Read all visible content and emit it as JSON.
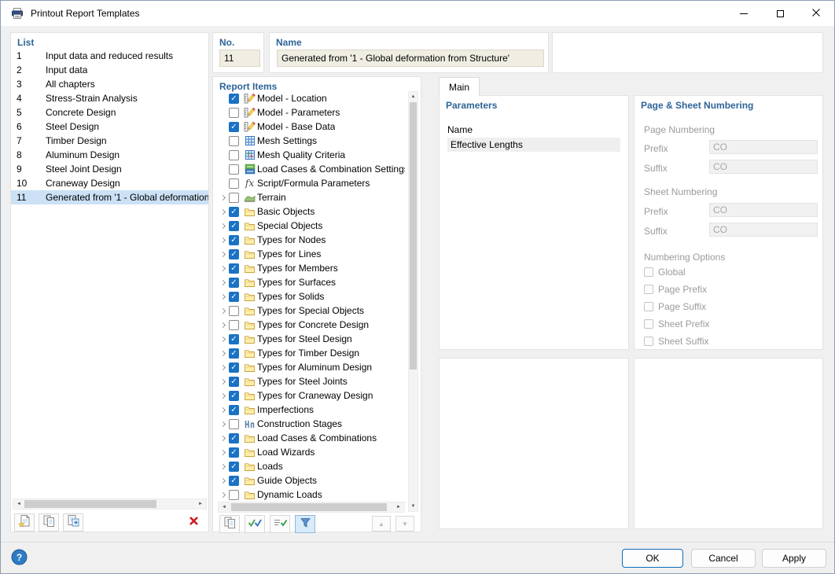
{
  "window": {
    "title": "Printout Report Templates"
  },
  "list_panel": {
    "header": "List",
    "items": [
      {
        "no": "1",
        "name": "Input data and reduced results",
        "selected": false
      },
      {
        "no": "2",
        "name": "Input data",
        "selected": false
      },
      {
        "no": "3",
        "name": "All chapters",
        "selected": false
      },
      {
        "no": "4",
        "name": "Stress-Strain Analysis",
        "selected": false
      },
      {
        "no": "5",
        "name": "Concrete Design",
        "selected": false
      },
      {
        "no": "6",
        "name": "Steel Design",
        "selected": false
      },
      {
        "no": "7",
        "name": "Timber Design",
        "selected": false
      },
      {
        "no": "8",
        "name": "Aluminum Design",
        "selected": false
      },
      {
        "no": "9",
        "name": "Steel Joint Design",
        "selected": false
      },
      {
        "no": "10",
        "name": "Craneway Design",
        "selected": false
      },
      {
        "no": "11",
        "name": "Generated from '1 - Global deformation",
        "selected": true
      }
    ]
  },
  "header_fields": {
    "no_label": "No.",
    "no_value": "11",
    "name_label": "Name",
    "name_value": "Generated from '1 - Global deformation from Structure'"
  },
  "report_items": {
    "header": "Report Items",
    "items": [
      {
        "label": "Model - Location",
        "checked": true,
        "icon": "model",
        "expand": false
      },
      {
        "label": "Model - Parameters",
        "checked": false,
        "icon": "model",
        "expand": false
      },
      {
        "label": "Model - Base Data",
        "checked": true,
        "icon": "model",
        "expand": false
      },
      {
        "label": "Mesh Settings",
        "checked": false,
        "icon": "mesh",
        "expand": false
      },
      {
        "label": "Mesh Quality Criteria",
        "checked": false,
        "icon": "mesh-quality",
        "expand": false
      },
      {
        "label": "Load Cases & Combination Settings",
        "checked": false,
        "icon": "load-settings",
        "expand": false
      },
      {
        "label": "Script/Formula Parameters",
        "checked": false,
        "icon": "formula",
        "expand": false
      },
      {
        "label": "Terrain",
        "checked": false,
        "icon": "terrain",
        "expand": true
      },
      {
        "label": "Basic Objects",
        "checked": true,
        "icon": "folder",
        "expand": true
      },
      {
        "label": "Special Objects",
        "checked": true,
        "icon": "folder",
        "expand": true
      },
      {
        "label": "Types for Nodes",
        "checked": true,
        "icon": "folder",
        "expand": true
      },
      {
        "label": "Types for Lines",
        "checked": true,
        "icon": "folder",
        "expand": true
      },
      {
        "label": "Types for Members",
        "checked": true,
        "icon": "folder",
        "expand": true
      },
      {
        "label": "Types for Surfaces",
        "checked": true,
        "icon": "folder",
        "expand": true
      },
      {
        "label": "Types for Solids",
        "checked": true,
        "icon": "folder",
        "expand": true
      },
      {
        "label": "Types for Special Objects",
        "checked": false,
        "icon": "folder",
        "expand": true
      },
      {
        "label": "Types for Concrete Design",
        "checked": false,
        "icon": "folder",
        "expand": true
      },
      {
        "label": "Types for Steel Design",
        "checked": true,
        "icon": "folder",
        "expand": true
      },
      {
        "label": "Types for Timber Design",
        "checked": true,
        "icon": "folder",
        "expand": true
      },
      {
        "label": "Types for Aluminum Design",
        "checked": true,
        "icon": "folder",
        "expand": true
      },
      {
        "label": "Types for Steel Joints",
        "checked": true,
        "icon": "folder",
        "expand": true
      },
      {
        "label": "Types for Craneway Design",
        "checked": true,
        "icon": "folder",
        "expand": true
      },
      {
        "label": "Imperfections",
        "checked": true,
        "icon": "folder",
        "expand": true
      },
      {
        "label": "Construction Stages",
        "checked": false,
        "icon": "construction-stages",
        "expand": true
      },
      {
        "label": "Load Cases & Combinations",
        "checked": true,
        "icon": "folder",
        "expand": true
      },
      {
        "label": "Load Wizards",
        "checked": true,
        "icon": "folder",
        "expand": true
      },
      {
        "label": "Loads",
        "checked": true,
        "icon": "folder",
        "expand": true
      },
      {
        "label": "Guide Objects",
        "checked": true,
        "icon": "folder",
        "expand": true
      },
      {
        "label": "Dynamic Loads",
        "checked": false,
        "icon": "folder",
        "expand": true
      }
    ]
  },
  "main_tab": {
    "label": "Main"
  },
  "parameters": {
    "header": "Parameters",
    "name_label": "Name",
    "rows": [
      {
        "value": "Effective Lengths"
      }
    ]
  },
  "numbering": {
    "header": "Page & Sheet Numbering",
    "page_section": "Page Numbering",
    "sheet_section": "Sheet Numbering",
    "prefix_label": "Prefix",
    "suffix_label": "Suffix",
    "page_prefix": "CO",
    "page_suffix": "CO",
    "sheet_prefix": "CO",
    "sheet_suffix": "CO",
    "options_label": "Numbering Options",
    "options": [
      "Global",
      "Page Prefix",
      "Page Suffix",
      "Sheet Prefix",
      "Sheet Suffix"
    ]
  },
  "toolbars": {
    "list": [
      "new-template",
      "copy-template",
      "template-from-file",
      "delete-template"
    ],
    "tree": [
      "copy-items",
      "check-selection",
      "check-subitems",
      "filter"
    ],
    "tree_nav": [
      "move-up",
      "move-down"
    ]
  },
  "footer": {
    "ok": "OK",
    "cancel": "Cancel",
    "apply": "Apply"
  }
}
